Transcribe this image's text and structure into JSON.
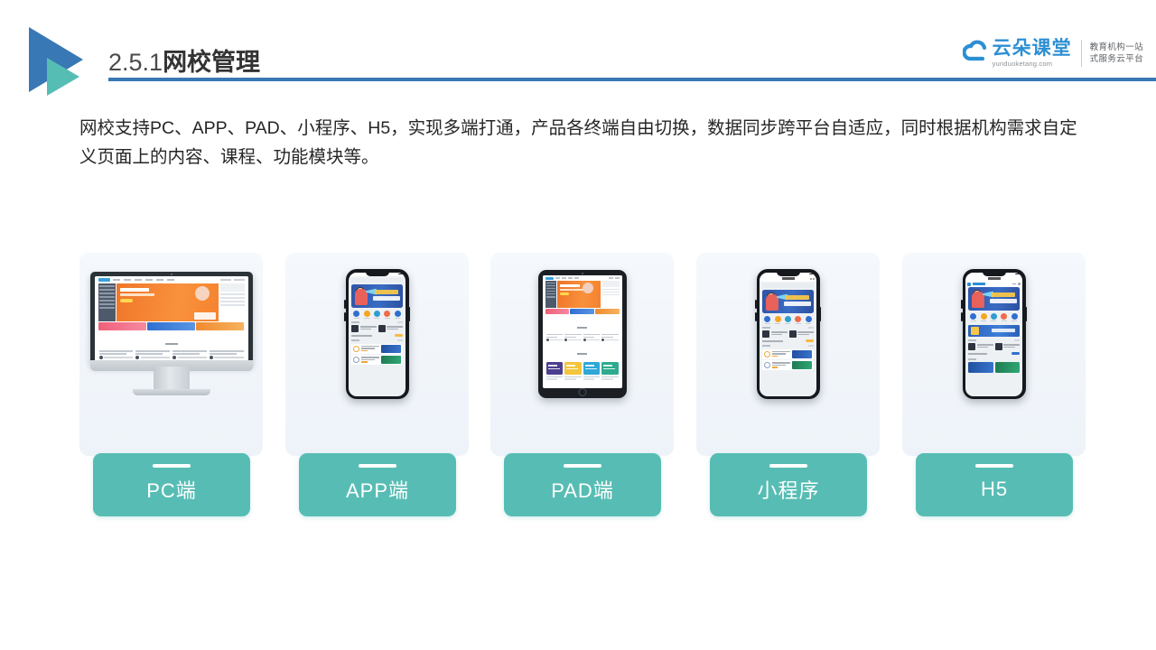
{
  "header": {
    "title_number": "2.5.1",
    "title_text": "网校管理",
    "decoration_icon": "double-triangle-play-icon",
    "rule_color": "#3878b4"
  },
  "logo": {
    "icon": "cloud-icon",
    "name_cn": "云朵课堂",
    "domain": "yunduoketang.com",
    "tagline_line1": "教育机构一站",
    "tagline_line2": "式服务云平台",
    "brand_color": "#2c8fd4"
  },
  "body": {
    "paragraph": "网校支持PC、APP、PAD、小程序、H5，实现多端打通，产品各终端自由切换，数据同步跨平台自适应，同时根据机构需求自定义页面上的内容、课程、功能模块等。"
  },
  "accent": {
    "teal": "#57bdb4",
    "card_bg": "#f2f6fb",
    "blue": "#3878b4"
  },
  "cards": [
    {
      "id": "pc",
      "label": "PC端",
      "device": "desktop-monitor-icon"
    },
    {
      "id": "app",
      "label": "APP端",
      "device": "smartphone-icon"
    },
    {
      "id": "pad",
      "label": "PAD端",
      "device": "tablet-icon"
    },
    {
      "id": "mini",
      "label": "小程序",
      "device": "smartphone-icon"
    },
    {
      "id": "h5",
      "label": "H5",
      "device": "smartphone-icon"
    }
  ]
}
